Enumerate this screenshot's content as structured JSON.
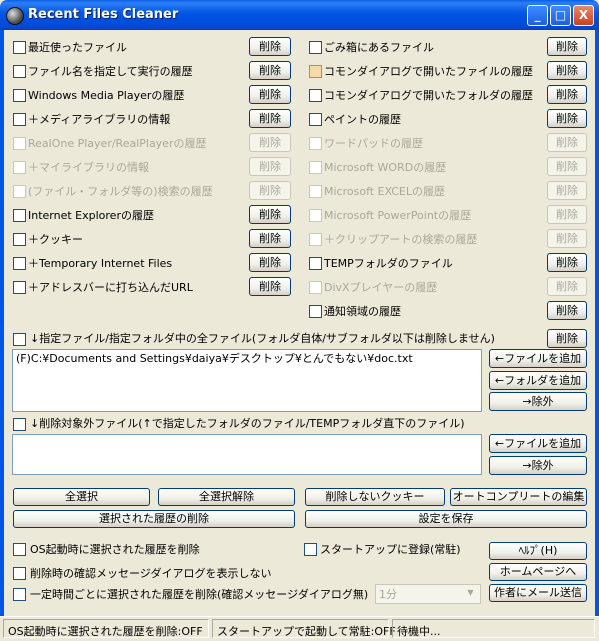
{
  "window": {
    "title": "Recent Files Cleaner",
    "minimize": "_",
    "maximize": "□",
    "close": "X"
  },
  "history_left": [
    {
      "label": "最近使ったファイル",
      "delete": "削除",
      "enabled": true
    },
    {
      "label": "ファイル名を指定して実行の履歴",
      "delete": "削除",
      "enabled": true
    },
    {
      "label": "Windows Media Playerの履歴",
      "delete": "削除",
      "enabled": true
    },
    {
      "label": "＋メディアライブラリの情報",
      "delete": "削除",
      "enabled": true
    },
    {
      "label": "RealOne Player/RealPlayerの履歴",
      "delete": "削除",
      "enabled": false
    },
    {
      "label": "＋マイライブラリの情報",
      "delete": "削除",
      "enabled": false
    },
    {
      "label": "(ファイル・フォルダ等の)検索の履歴",
      "delete": "削除",
      "enabled": false
    },
    {
      "label": "Internet Explorerの履歴",
      "delete": "削除",
      "enabled": true
    },
    {
      "label": "＋クッキー",
      "delete": "削除",
      "enabled": true
    },
    {
      "label": "＋Temporary Internet Files",
      "delete": "削除",
      "enabled": true
    },
    {
      "label": "＋アドレスバーに打ち込んだURL",
      "delete": "削除",
      "enabled": true
    }
  ],
  "history_right": [
    {
      "label": "ごみ箱にあるファイル",
      "delete": "削除",
      "enabled": true
    },
    {
      "label": "コモンダイアログで開いたファイルの履歴",
      "delete": "削除",
      "enabled": true
    },
    {
      "label": "コモンダイアログで開いたフォルダの履歴",
      "delete": "削除",
      "enabled": true
    },
    {
      "label": "ペイントの履歴",
      "delete": "削除",
      "enabled": true
    },
    {
      "label": "ワードパッドの履歴",
      "delete": "削除",
      "enabled": false
    },
    {
      "label": "Microsoft WORDの履歴",
      "delete": "削除",
      "enabled": false
    },
    {
      "label": "Microsoft EXCELの履歴",
      "delete": "削除",
      "enabled": false
    },
    {
      "label": "Microsoft PowerPointの履歴",
      "delete": "削除",
      "enabled": false
    },
    {
      "label": "＋クリップアートの検索の履歴",
      "delete": "削除",
      "enabled": false
    },
    {
      "label": "TEMPフォルダのファイル",
      "delete": "削除",
      "enabled": true
    },
    {
      "label": "DivXプレイヤーの履歴",
      "delete": "削除",
      "enabled": false
    },
    {
      "label": "通知領域の履歴",
      "delete": "削除",
      "enabled": true
    }
  ],
  "target_section": {
    "label": "↓指定ファイル/指定フォルダ中の全ファイル(フォルダ自体/サブフォルダ以下は削除しません)",
    "delete": "削除",
    "items": [
      "(F)C:¥Documents and Settings¥daiya¥デスクトップ¥とんでもない¥doc.txt"
    ],
    "add_file": "←ファイルを追加",
    "add_folder": "←フォルダを追加",
    "remove": "→除外"
  },
  "exclude_section": {
    "label": "↓削除対象外ファイル(↑で指定したフォルダのファイル/TEMPフォルダ直下のファイル)",
    "add_file": "←ファイルを追加",
    "remove": "→除外"
  },
  "actions": {
    "select_all": "全選択",
    "deselect_all": "全選択解除",
    "keep_cookies": "削除しないクッキー",
    "autocomplete_edit": "オートコンプリートの編集",
    "delete_selected": "選択された履歴の削除",
    "save_settings": "設定を保存"
  },
  "options": {
    "startup_delete": "OS起動時に選択された履歴を削除",
    "register_startup": "スタートアップに登録(常駐)",
    "confirm_dialog": "削除時の確認メッセージダイアログを表示しない",
    "periodic_delete": "一定時間ごとに選択された履歴を削除(確認メッセージダイアログ無)",
    "interval_value": "1分",
    "help": "ﾍﾙﾌﾟ(H)",
    "homepage": "ホームページへ",
    "mail_author": "作者にメール送信"
  },
  "statusbar": {
    "startup_delete_status": "OS起動時に選択された履歴を削除:OFF",
    "startup_resident_status": "スタートアップで起動して常駐:OFF",
    "state": "待機中..."
  },
  "colors": {
    "title_blue": "#0055E5",
    "face": "#ECE9D8",
    "disabled_text": "#ACA899"
  }
}
